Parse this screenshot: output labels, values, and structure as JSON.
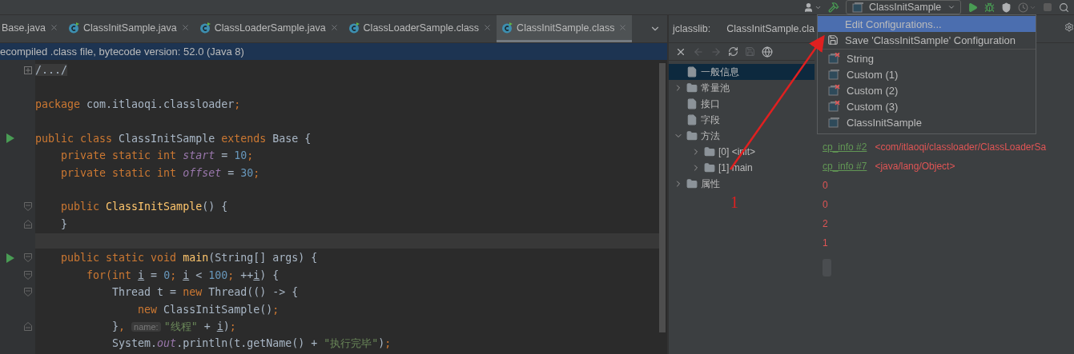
{
  "toolbar": {
    "run_config": "ClassInitSample"
  },
  "tabs": [
    {
      "label": "Base.java",
      "icon": false,
      "selected": false
    },
    {
      "label": "ClassInitSample.java",
      "icon": true,
      "selected": false
    },
    {
      "label": "ClassLoaderSample.java",
      "icon": true,
      "selected": false
    },
    {
      "label": "ClassLoaderSample.class",
      "icon": true,
      "selected": false
    },
    {
      "label": "ClassInitSample.class",
      "icon": true,
      "selected": true
    }
  ],
  "info_bar": "ecompiled .class file, bytecode version: 52.0 (Java 8)",
  "code": [
    {
      "kind": "collapsed",
      "run": false,
      "current": false,
      "tokens": [
        {
          "kind": "folded",
          "text": "/.../"
        }
      ]
    },
    {
      "kind": "plain",
      "run": false,
      "current": false
    },
    {
      "kind": "plain",
      "run": false,
      "current": false,
      "tokens": [
        {
          "kind": "kw",
          "text": "package"
        },
        {
          "kind": "plain",
          "text": " com.itlaoqi.classloader"
        },
        {
          "kind": "kw",
          "text": ";"
        }
      ]
    },
    {
      "kind": "plain",
      "run": false,
      "current": false
    },
    {
      "kind": "plain",
      "run": true,
      "current": false,
      "tokens": [
        {
          "kind": "kw",
          "text": "public class"
        },
        {
          "kind": "plain",
          "text": " ClassInitSample "
        },
        {
          "kind": "kw",
          "text": "extends"
        },
        {
          "kind": "plain",
          "text": " Base {"
        }
      ]
    },
    {
      "kind": "plain",
      "run": false,
      "current": false,
      "tokens": [
        {
          "kind": "kw",
          "text": "    private static int "
        },
        {
          "kind": "field",
          "text": "start"
        },
        {
          "kind": "plain",
          "text": " = "
        },
        {
          "kind": "num",
          "text": "10"
        },
        {
          "kind": "kw",
          "text": ";"
        }
      ]
    },
    {
      "kind": "plain",
      "run": false,
      "current": false,
      "tokens": [
        {
          "kind": "kw",
          "text": "    private static int "
        },
        {
          "kind": "field",
          "text": "offset"
        },
        {
          "kind": "plain",
          "text": " = "
        },
        {
          "kind": "num",
          "text": "30"
        },
        {
          "kind": "kw",
          "text": ";"
        }
      ]
    },
    {
      "kind": "plain",
      "run": false,
      "current": false
    },
    {
      "kind": "open",
      "run": false,
      "current": false,
      "tokens": [
        {
          "kind": "kw",
          "text": "    public "
        },
        {
          "kind": "method",
          "text": "ClassInitSample"
        },
        {
          "kind": "plain",
          "text": "() {"
        }
      ]
    },
    {
      "kind": "close",
      "run": false,
      "current": false,
      "tokens": [
        {
          "kind": "plain",
          "text": "    }"
        }
      ]
    },
    {
      "kind": "plain",
      "run": false,
      "current": true
    },
    {
      "kind": "open",
      "run": true,
      "current": false,
      "tokens": [
        {
          "kind": "kw",
          "text": "    public static void "
        },
        {
          "kind": "method",
          "text": "main"
        },
        {
          "kind": "plain",
          "text": "(String[] args) {"
        }
      ]
    },
    {
      "kind": "open",
      "run": false,
      "current": false,
      "tokens": [
        {
          "kind": "kw",
          "text": "        for(int "
        },
        {
          "kind": "var",
          "text": "i"
        },
        {
          "kind": "plain",
          "text": " = "
        },
        {
          "kind": "num",
          "text": "0"
        },
        {
          "kind": "kw",
          "text": "; "
        },
        {
          "kind": "var",
          "text": "i"
        },
        {
          "kind": "plain",
          "text": " < "
        },
        {
          "kind": "num",
          "text": "100"
        },
        {
          "kind": "kw",
          "text": "; "
        },
        {
          "kind": "plain",
          "text": "++"
        },
        {
          "kind": "var",
          "text": "i"
        },
        {
          "kind": "plain",
          "text": ") {"
        }
      ]
    },
    {
      "kind": "open",
      "run": false,
      "current": false,
      "tokens": [
        {
          "kind": "plain",
          "text": "            Thread t = "
        },
        {
          "kind": "kw",
          "text": "new "
        },
        {
          "kind": "plain",
          "text": "Thread(() -> {"
        }
      ]
    },
    {
      "kind": "plain",
      "run": false,
      "current": false,
      "tokens": [
        {
          "kind": "kw",
          "text": "                new "
        },
        {
          "kind": "plain",
          "text": "ClassInitSample()"
        },
        {
          "kind": "kw",
          "text": ";"
        }
      ]
    },
    {
      "kind": "close",
      "run": false,
      "current": false,
      "tokens": [
        {
          "kind": "plain",
          "text": "            }"
        },
        {
          "kind": "kw",
          "text": ", "
        },
        {
          "kind": "hint",
          "text": "name:"
        },
        {
          "kind": "str",
          "text": "\"线程\""
        },
        {
          "kind": "plain",
          "text": " + "
        },
        {
          "kind": "var",
          "text": "i"
        },
        {
          "kind": "plain",
          "text": ")"
        },
        {
          "kind": "kw",
          "text": ";"
        }
      ]
    },
    {
      "kind": "plain",
      "run": false,
      "current": false,
      "tokens": [
        {
          "kind": "plain",
          "text": "            System."
        },
        {
          "kind": "field",
          "text": "out"
        },
        {
          "kind": "plain",
          "text": ".println(t.getName() + "
        },
        {
          "kind": "str",
          "text": "\"执行完毕\""
        },
        {
          "kind": "plain",
          "text": ")"
        },
        {
          "kind": "kw",
          "text": ";"
        }
      ]
    }
  ],
  "jclasslib": {
    "label": "jclasslib:",
    "file": "ClassInitSample.cla",
    "tree": [
      {
        "label": "一般信息",
        "kind": "file",
        "selected": true
      },
      {
        "label": "常量池",
        "kind": "folder",
        "expanded": false,
        "selected": false
      },
      {
        "label": "接口",
        "kind": "file",
        "selected": false
      },
      {
        "label": "字段",
        "kind": "file",
        "selected": false
      },
      {
        "label": "方法",
        "kind": "folder",
        "expanded": true,
        "selected": false,
        "children": [
          {
            "label": "[0] <init>",
            "kind": "folder",
            "expanded": false,
            "selected": false
          },
          {
            "label": "[1] main",
            "kind": "folder",
            "expanded": false,
            "selected": false
          }
        ]
      },
      {
        "label": "属性",
        "kind": "folder",
        "expanded": false,
        "selected": false
      }
    ],
    "details": [
      {
        "kind": "link",
        "link": "cp_info #2",
        "text": "<com/itlaoqi/classloader/ClassLoaderSa"
      },
      {
        "kind": "link",
        "link": "cp_info #7",
        "text": "<java/lang/Object>"
      },
      {
        "kind": "value",
        "text": "0"
      },
      {
        "kind": "value",
        "text": "0"
      },
      {
        "kind": "value",
        "text": "2"
      },
      {
        "kind": "value",
        "text": "1"
      }
    ]
  },
  "menu": [
    {
      "label": "Edit Configurations...",
      "kind": "edit",
      "error": false,
      "selected": true
    },
    {
      "label": "Save 'ClassInitSample' Configuration",
      "kind": "save",
      "error": false,
      "selected": false
    },
    {
      "label": "String",
      "kind": "config",
      "error": true,
      "selected": false
    },
    {
      "label": "Custom (1)",
      "kind": "config",
      "error": false,
      "selected": false
    },
    {
      "label": "Custom (2)",
      "kind": "config",
      "error": true,
      "selected": false
    },
    {
      "label": "Custom (3)",
      "kind": "config",
      "error": true,
      "selected": false
    },
    {
      "label": "ClassInitSample",
      "kind": "config",
      "error": false,
      "selected": false
    }
  ],
  "annotation": {
    "label": "1"
  }
}
